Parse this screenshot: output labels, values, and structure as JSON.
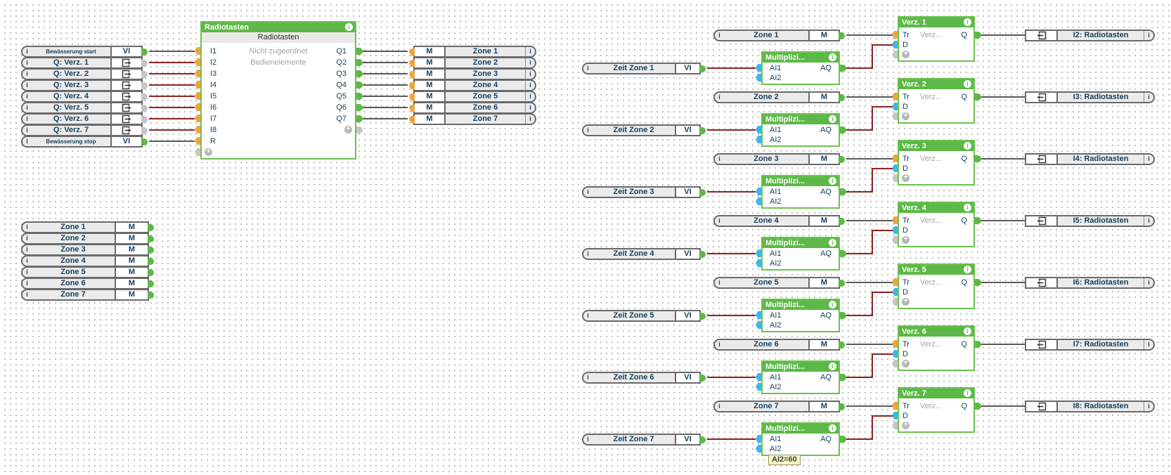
{
  "colors": {
    "block_green": "#5cb947",
    "block_border_green": "#6cc24f",
    "connector_orange": "#f3a33b",
    "connector_cyan": "#3db7e8",
    "connector_gray": "#c6c6c6",
    "wire_gray": "#5a5a5a",
    "wire_red": "#8e2323",
    "text_navy": "#17405e",
    "text_ghost": "#a3a3a3",
    "ref_label_bg": "#ebebeb",
    "ref_border": "#6a6a6a",
    "grid_dot": "#c4c4c4",
    "tooltip_bg": "#fbf6c0",
    "tooltip_border": "#9a9464"
  },
  "glyphs": {
    "info": "i",
    "plus": "+"
  },
  "ports": {
    "vi": "VI",
    "m": "M",
    "ai1": "AI1",
    "ai2": "AI2",
    "aq": "AQ",
    "tr": "Tr",
    "d": "D",
    "q": "Q"
  },
  "labels": {
    "mult_title": "Multiplizi...",
    "verz_ghost": "Verz..."
  },
  "left_inputs": [
    {
      "label": "Bewässerung start",
      "port": "VI",
      "kind": "vi",
      "small": true
    },
    {
      "label": "Q: Verz. 1",
      "kind": "ref"
    },
    {
      "label": "Q: Verz. 2",
      "kind": "ref"
    },
    {
      "label": "Q: Verz. 3",
      "kind": "ref"
    },
    {
      "label": "Q: Verz. 4",
      "kind": "ref"
    },
    {
      "label": "Q: Verz. 5",
      "kind": "ref"
    },
    {
      "label": "Q: Verz. 6",
      "kind": "ref"
    },
    {
      "label": "Q: Verz. 7",
      "kind": "ref"
    },
    {
      "label": "Bewässerung stop",
      "port": "VI",
      "kind": "vi",
      "small": true
    }
  ],
  "radiotasten": {
    "title": "Radiotasten",
    "subtitle": "Radiotasten",
    "descriptions": [
      "Nicht zugeordnet",
      "Bedienelemente"
    ],
    "inputs": [
      "I1",
      "I2",
      "I3",
      "I4",
      "I5",
      "I6",
      "I7",
      "I8",
      "R"
    ],
    "outputs": [
      "Q1",
      "Q2",
      "Q3",
      "Q4",
      "Q5",
      "Q6",
      "Q7"
    ]
  },
  "zone_outputs": [
    {
      "port": "M",
      "label": "Zone 1"
    },
    {
      "port": "M",
      "label": "Zone 2"
    },
    {
      "port": "M",
      "label": "Zone 3"
    },
    {
      "port": "M",
      "label": "Zone 4"
    },
    {
      "port": "M",
      "label": "Zone 5"
    },
    {
      "port": "M",
      "label": "Zone 6"
    },
    {
      "port": "M",
      "label": "Zone 7"
    }
  ],
  "memory_flags": [
    {
      "label": "Zone 1",
      "port": "M"
    },
    {
      "label": "Zone 2",
      "port": "M"
    },
    {
      "label": "Zone 3",
      "port": "M"
    },
    {
      "label": "Zone 4",
      "port": "M"
    },
    {
      "label": "Zone 5",
      "port": "M"
    },
    {
      "label": "Zone 6",
      "port": "M"
    },
    {
      "label": "Zone 7",
      "port": "M"
    }
  ],
  "groups": [
    {
      "zone": "Zone 1",
      "zeit": "Zeit Zone 1",
      "verz": "Verz. 1",
      "target": "I2: Radiotasten"
    },
    {
      "zone": "Zone 2",
      "zeit": "Zeit Zone 2",
      "verz": "Verz. 2",
      "target": "I3: Radiotasten"
    },
    {
      "zone": "Zone 3",
      "zeit": "Zeit Zone 3",
      "verz": "Verz. 3",
      "target": "I4: Radiotasten"
    },
    {
      "zone": "Zone 4",
      "zeit": "Zeit Zone 4",
      "verz": "Verz. 4",
      "target": "I5: Radiotasten"
    },
    {
      "zone": "Zone 5",
      "zeit": "Zeit Zone 5",
      "verz": "Verz. 5",
      "target": "I6: Radiotasten"
    },
    {
      "zone": "Zone 6",
      "zeit": "Zeit Zone 6",
      "verz": "Verz. 6",
      "target": "I7: Radiotasten"
    },
    {
      "zone": "Zone 7",
      "zeit": "Zeit Zone 7",
      "verz": "Verz. 7",
      "target": "I8: Radiotasten"
    }
  ],
  "tooltip": {
    "text": "AI2=60"
  }
}
